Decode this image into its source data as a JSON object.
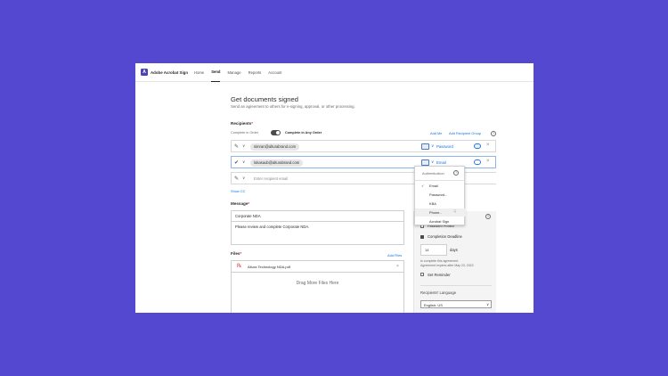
{
  "topnav": {
    "logo_letter": "A",
    "brand": "Adobe Acrobat Sign",
    "items": [
      {
        "label": "Home"
      },
      {
        "label": "Send"
      },
      {
        "label": "Manage"
      },
      {
        "label": "Reports"
      },
      {
        "label": "Account"
      }
    ],
    "active_item": "Send"
  },
  "page": {
    "title": "Get documents signed",
    "subtitle": "Send an agreement to others for e-signing, approval, or other processing."
  },
  "recipients": {
    "label": "Recipients",
    "required_mark": "*",
    "complete_in_order": "Complete in Order",
    "complete_in_any_order": "Complete in Any Order",
    "add_me": "Add Me",
    "add_recipient_group": "Add Recipient Group",
    "rows": [
      {
        "email": "simran@alturabrand.com",
        "auth": "Password"
      },
      {
        "email": "lokasaub@alturabrand.com",
        "auth": "Email"
      }
    ],
    "empty_placeholder": "Enter recipient email",
    "show_cc": "Show CC"
  },
  "auth_dropdown": {
    "header": "Authentication",
    "options": [
      {
        "label": "Email",
        "checked": true
      },
      {
        "label": "Password...",
        "checked": false
      },
      {
        "label": "KBA",
        "checked": false
      },
      {
        "label": "Phone...",
        "checked": false
      },
      {
        "label": "Acrobat Sign",
        "checked": false
      }
    ],
    "hovered_option": "Phone..."
  },
  "message": {
    "label": "Message",
    "required_mark": "*",
    "subject": "Corporate NDA",
    "body": "Please review and complete Corporate NDA."
  },
  "files": {
    "label": "Files",
    "required_mark": "*",
    "add_files": "Add Files",
    "items": [
      {
        "name": "Altura Technology NDA.pdf"
      }
    ],
    "drop_zone": "Drag More Files Here"
  },
  "options_panel": {
    "password_protect": "Password Protect",
    "completion_deadline": "Completion Deadline",
    "days_value": "14",
    "days_label": "days",
    "deadline_note_1": "to complete this agreement.",
    "deadline_note_2": "Agreement expires after May 23, 2022.",
    "set_reminder": "Set Reminder",
    "language_label": "Recipients' Language",
    "language_value": "English: US"
  },
  "colors": {
    "background": "#5447d0",
    "accent": "#1473e6",
    "brand": "#4b45b5",
    "required": "#d7373f"
  }
}
